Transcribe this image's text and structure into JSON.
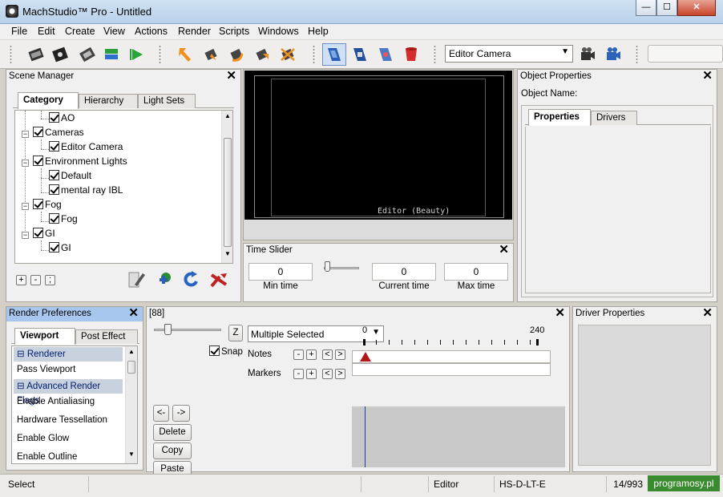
{
  "window": {
    "title": "MachStudio™ Pro - Untitled",
    "minimize": "—",
    "maximize": "☐",
    "close": "✕"
  },
  "menu": [
    "File",
    "Edit",
    "Create",
    "View",
    "Actions",
    "Render",
    "Scripts",
    "Windows",
    "Help"
  ],
  "toolbar": {
    "camera_select": "Editor Camera"
  },
  "scene_manager": {
    "title": "Scene Manager",
    "tabs": [
      "Category",
      "Hierarchy",
      "Light Sets"
    ],
    "tree": [
      {
        "label": "AO",
        "level": 2
      },
      {
        "label": "Cameras",
        "level": 1
      },
      {
        "label": "Editor Camera",
        "level": 2
      },
      {
        "label": "Environment Lights",
        "level": 1
      },
      {
        "label": "Default",
        "level": 2
      },
      {
        "label": "mental ray IBL",
        "level": 2
      },
      {
        "label": "Fog",
        "level": 1
      },
      {
        "label": "Fog",
        "level": 2
      },
      {
        "label": "GI",
        "level": 1
      },
      {
        "label": "GI",
        "level": 2
      }
    ],
    "buttons": [
      "+",
      "-",
      ";"
    ]
  },
  "viewport": {
    "label": "Editor (Beauty)"
  },
  "time_slider": {
    "title": "Time Slider",
    "min_time": "0",
    "current_time": "0",
    "max_time": "0",
    "min_label": "Min time",
    "current_label": "Current time",
    "max_label": "Max time"
  },
  "object_properties": {
    "title": "Object Properties",
    "name_label": "Object Name:",
    "tabs": [
      "Properties",
      "Drivers"
    ]
  },
  "render_preferences": {
    "title": "Render Preferences",
    "tabs": [
      "Viewport",
      "Post Effect"
    ],
    "items": [
      {
        "label": "⊟ Renderer",
        "header": true
      },
      {
        "label": "Pass Viewport",
        "header": false
      },
      {
        "label": "⊟ Advanced Render Flags",
        "header": true
      },
      {
        "label": "Enable Antialiasing",
        "header": false
      },
      {
        "label": "Hardware Tessellation",
        "header": false
      },
      {
        "label": "Enable Glow",
        "header": false
      },
      {
        "label": "Enable Outline",
        "header": false
      }
    ]
  },
  "timeline": {
    "title": "[88]",
    "z_button": "Z",
    "snap_label": "Snap",
    "selection": "Multiple Selected",
    "start_frame": "0",
    "end_frame": "240",
    "notes_label": "Notes",
    "markers_label": "Markers",
    "nav_prev": "<-",
    "nav_next": "->",
    "delete": "Delete",
    "copy": "Copy",
    "paste": "Paste",
    "track_buttons": [
      "-",
      "+",
      "<",
      ">"
    ]
  },
  "driver_properties": {
    "title": "Driver Properties"
  },
  "status": {
    "left": "Select",
    "mode": "Editor",
    "code": "HS-D-LT-E",
    "count": "14/993"
  },
  "watermark": "programosy.pl",
  "colors": {
    "viewport_bg": "#000000",
    "title_gradient": "#b9d1ea",
    "selected_header": "#a8c7ee"
  }
}
